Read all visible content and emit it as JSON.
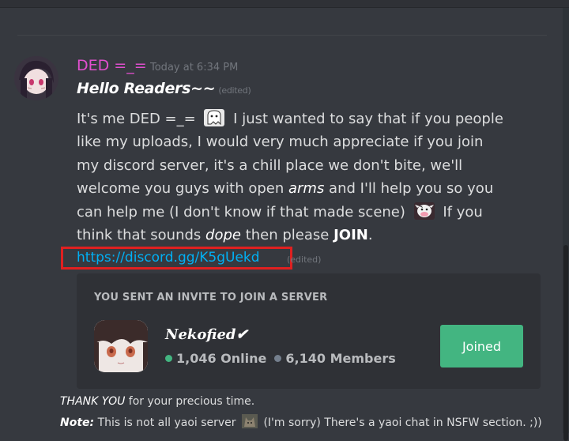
{
  "message": {
    "username": "DED =_=",
    "timestamp": "Today at 6:34 PM",
    "headline": "Hello Readers~~",
    "edited_label": "(edited)",
    "body_lines": [
      [
        "It's me DED =_= ",
        "{emoji:ghost}",
        " I just wanted to say that if you people"
      ],
      [
        "like my uploads, I would  very much appreciate if you join"
      ],
      [
        "my discord server, it's a chill place we don't bite, we'll"
      ],
      [
        "welcome you guys with open ",
        "{em:arms}",
        " and I'll help you so you"
      ],
      [
        "can help me (I don't know if that made scene) ",
        "{emoji:cow}",
        " If you"
      ],
      [
        "think that sounds ",
        "{em:dope}",
        " then please ",
        "{strong:JOIN}",
        "."
      ]
    ],
    "link_text": "https://discord.gg/K5gUekd",
    "link_edited": "(edited)"
  },
  "invite": {
    "header": "YOU SENT AN INVITE TO JOIN A SERVER",
    "server_name": "Nekofied✔",
    "online_count": "1,046 Online",
    "member_count": "6,140 Members",
    "join_label": "Joined"
  },
  "footer": {
    "thanks_em": "THANK YOU",
    "thanks_rest": " for your precious time.",
    "note_label": "Note:",
    "note_text_1": " This is not all yaoi server ",
    "note_text_2": " (I'm sorry) There's a yaoi chat in NSFW section. ;))"
  },
  "colors": {
    "background": "#36393f",
    "username": "#e04fce",
    "link": "#00b0f4",
    "joined_button": "#43b581",
    "online_dot": "#43b581",
    "member_dot": "#747f8d",
    "highlight": "#e02020"
  }
}
